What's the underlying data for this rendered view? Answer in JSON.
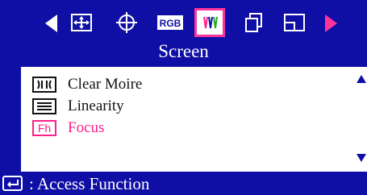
{
  "screen": {
    "title": "Screen"
  },
  "tabs": [
    {
      "icon": "position-icon"
    },
    {
      "icon": "geometry-icon"
    },
    {
      "icon": "rgb-color-icon",
      "text": "RGB"
    },
    {
      "icon": "screen-icon",
      "selected": true
    },
    {
      "icon": "copy-windows-icon"
    },
    {
      "icon": "window-icon"
    }
  ],
  "menu": {
    "items": [
      {
        "label": "Clear Moire",
        "icon": "clear-moire-icon"
      },
      {
        "label": "Linearity",
        "icon": "linearity-icon"
      },
      {
        "label": "Focus",
        "icon": "focus-icon",
        "icon_text": "Fh",
        "active": true
      }
    ]
  },
  "footer": {
    "text": ": Access Function",
    "icon": "enter-key-icon"
  },
  "colors": {
    "blue": "#0f0fa5",
    "magenta": "#ff1f8a",
    "white": "#ffffff",
    "text": "#111111"
  }
}
